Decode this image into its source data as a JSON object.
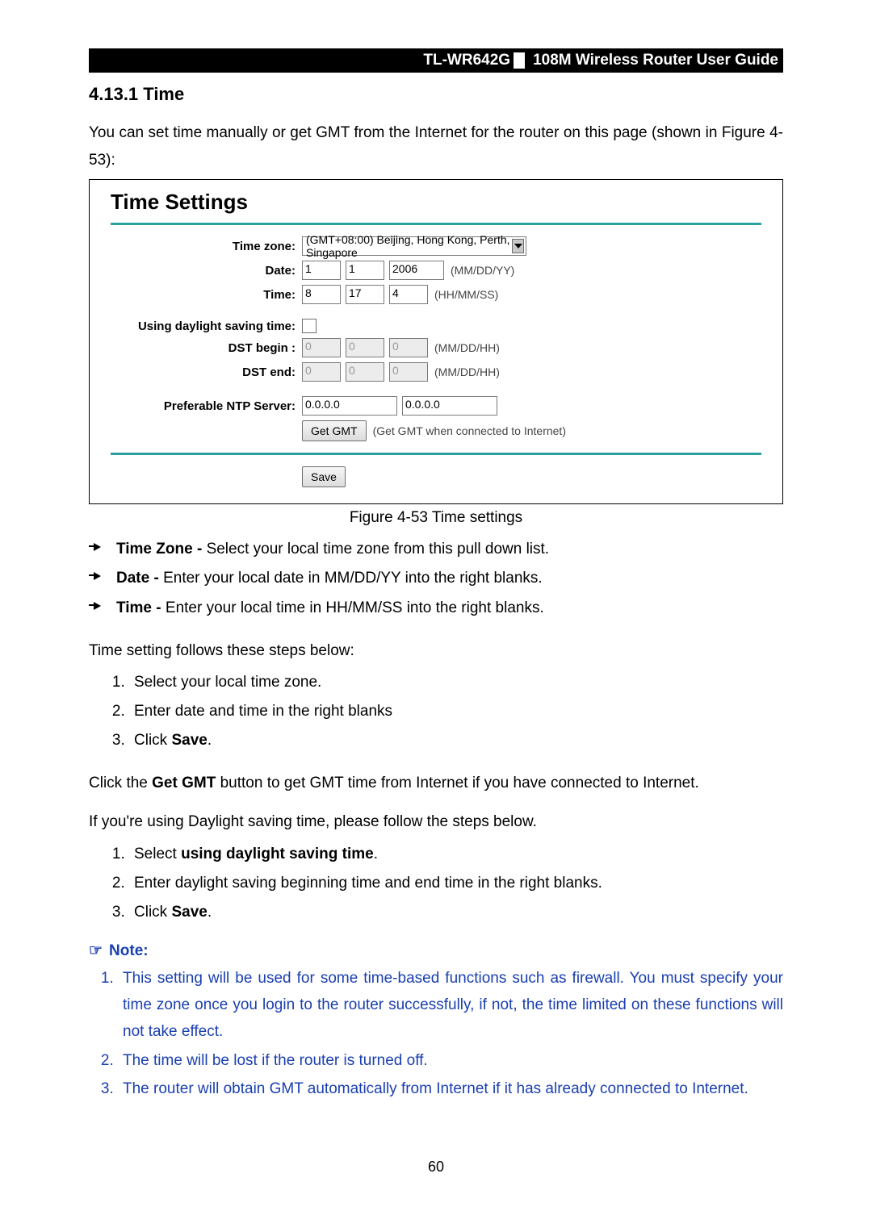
{
  "header": {
    "model": "TL-WR642G",
    "title": "108M  Wireless  Router  User  Guide"
  },
  "section_heading": "4.13.1 Time",
  "intro": "You can set time manually or get GMT from the Internet for the router on this page (shown in Figure 4-53):",
  "figure_caption": "Figure 4-53    Time settings",
  "screenshot": {
    "title": "Time Settings",
    "labels": {
      "timezone": "Time zone:",
      "date": "Date:",
      "time": "Time:",
      "use_dst": "Using daylight saving time:",
      "dst_begin": "DST begin :",
      "dst_end": "DST end:",
      "ntp": "Preferable NTP Server:"
    },
    "values": {
      "timezone": "(GMT+08:00) Beijing, Hong Kong, Perth, Singapore",
      "date_mm": "1",
      "date_dd": "1",
      "date_yy": "2006",
      "date_hint": "(MM/DD/YY)",
      "time_hh": "8",
      "time_mm": "17",
      "time_ss": "4",
      "time_hint": "(HH/MM/SS)",
      "dstb_mm": "0",
      "dstb_dd": "0",
      "dstb_hh": "0",
      "dstb_hint": "(MM/DD/HH)",
      "dste_mm": "0",
      "dste_dd": "0",
      "dste_hh": "0",
      "dste_hint": "(MM/DD/HH)",
      "ntp1": "0.0.0.0",
      "ntp2": "0.0.0.0",
      "get_gmt_btn": "Get GMT",
      "get_gmt_hint": "(Get GMT when connected to Internet)",
      "save_btn": "Save"
    }
  },
  "bullets": [
    {
      "b": "Time Zone - ",
      "t": "Select your local time zone from this pull down list."
    },
    {
      "b": "Date - ",
      "t": "Enter your local date in MM/DD/YY into the right blanks."
    },
    {
      "b": "Time - ",
      "t": "Enter your local time in HH/MM/SS into the right blanks."
    }
  ],
  "steps_intro": "Time setting follows these steps below:",
  "steps": [
    "Select your local time zone.",
    "Enter date and time in the right blanks",
    {
      "pre": "Click ",
      "b": "Save",
      "post": "."
    }
  ],
  "gmt_para": {
    "pre": "Click the ",
    "b": "Get GMT",
    "post": " button to get GMT time from Internet if you have connected to Internet."
  },
  "dst_intro": "If you're using Daylight saving time, please follow the steps below.",
  "dst_steps": [
    {
      "pre": "Select ",
      "b": "using daylight saving time",
      "post": "."
    },
    "Enter daylight saving beginning time and end time in the right blanks.",
    {
      "pre": "Click ",
      "b": "Save",
      "post": "."
    }
  ],
  "note_label": "Note:",
  "notes": [
    "This setting will be used for some time-based functions such as firewall. You must specify your time zone once you login to the router successfully, if not, the time limited on these functions will not take effect.",
    "The time will be lost if the router is turned off.",
    "The router will obtain GMT automatically from Internet if it has already connected to Internet."
  ],
  "page_number": "60"
}
